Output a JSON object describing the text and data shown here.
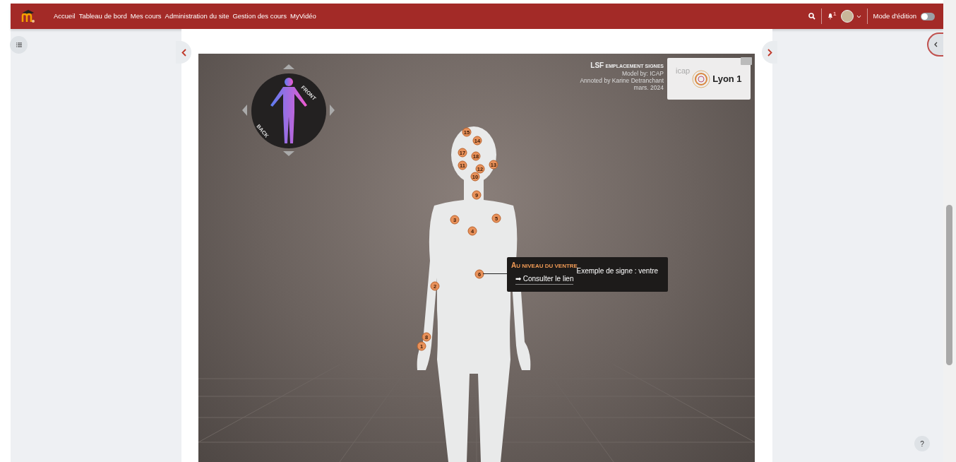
{
  "navbar": {
    "links": [
      {
        "label": "Accueil"
      },
      {
        "label": "Tableau de bord"
      },
      {
        "label": "Mes cours"
      },
      {
        "label": "Administration du site"
      },
      {
        "label": "Gestion des cours"
      },
      {
        "label": "MyVidéo"
      }
    ],
    "notification_count": "1",
    "edit_mode": {
      "label": "Mode d'édition",
      "on": false
    }
  },
  "viewer": {
    "title": "LSF",
    "subtitle": "EMPLACEMENT SIGNES",
    "credits": [
      "Model by: ICAP",
      "Annoted by Karine Detranchant",
      "mars. 2024"
    ],
    "logo": {
      "small_text": "icap",
      "text": "Lyon 1"
    },
    "navigator": {
      "front_label": "FRONT",
      "back_label": "BACK"
    },
    "annotations": [
      {
        "number": "15"
      },
      {
        "number": "14"
      },
      {
        "number": "17"
      },
      {
        "number": "18"
      },
      {
        "number": "11"
      },
      {
        "number": "12"
      },
      {
        "number": "13"
      },
      {
        "number": "10"
      },
      {
        "number": "9"
      },
      {
        "number": "3"
      },
      {
        "number": "5"
      },
      {
        "number": "4"
      },
      {
        "number": "6"
      },
      {
        "number": "2"
      },
      {
        "number": "8"
      },
      {
        "number": "1"
      }
    ],
    "tooltip": {
      "title": "AU NIVEAU DU VENTRE",
      "link": "Consulter le lien",
      "link_arrow": "➡",
      "description": "Exemple de signe : ventre"
    }
  },
  "help": "?"
}
